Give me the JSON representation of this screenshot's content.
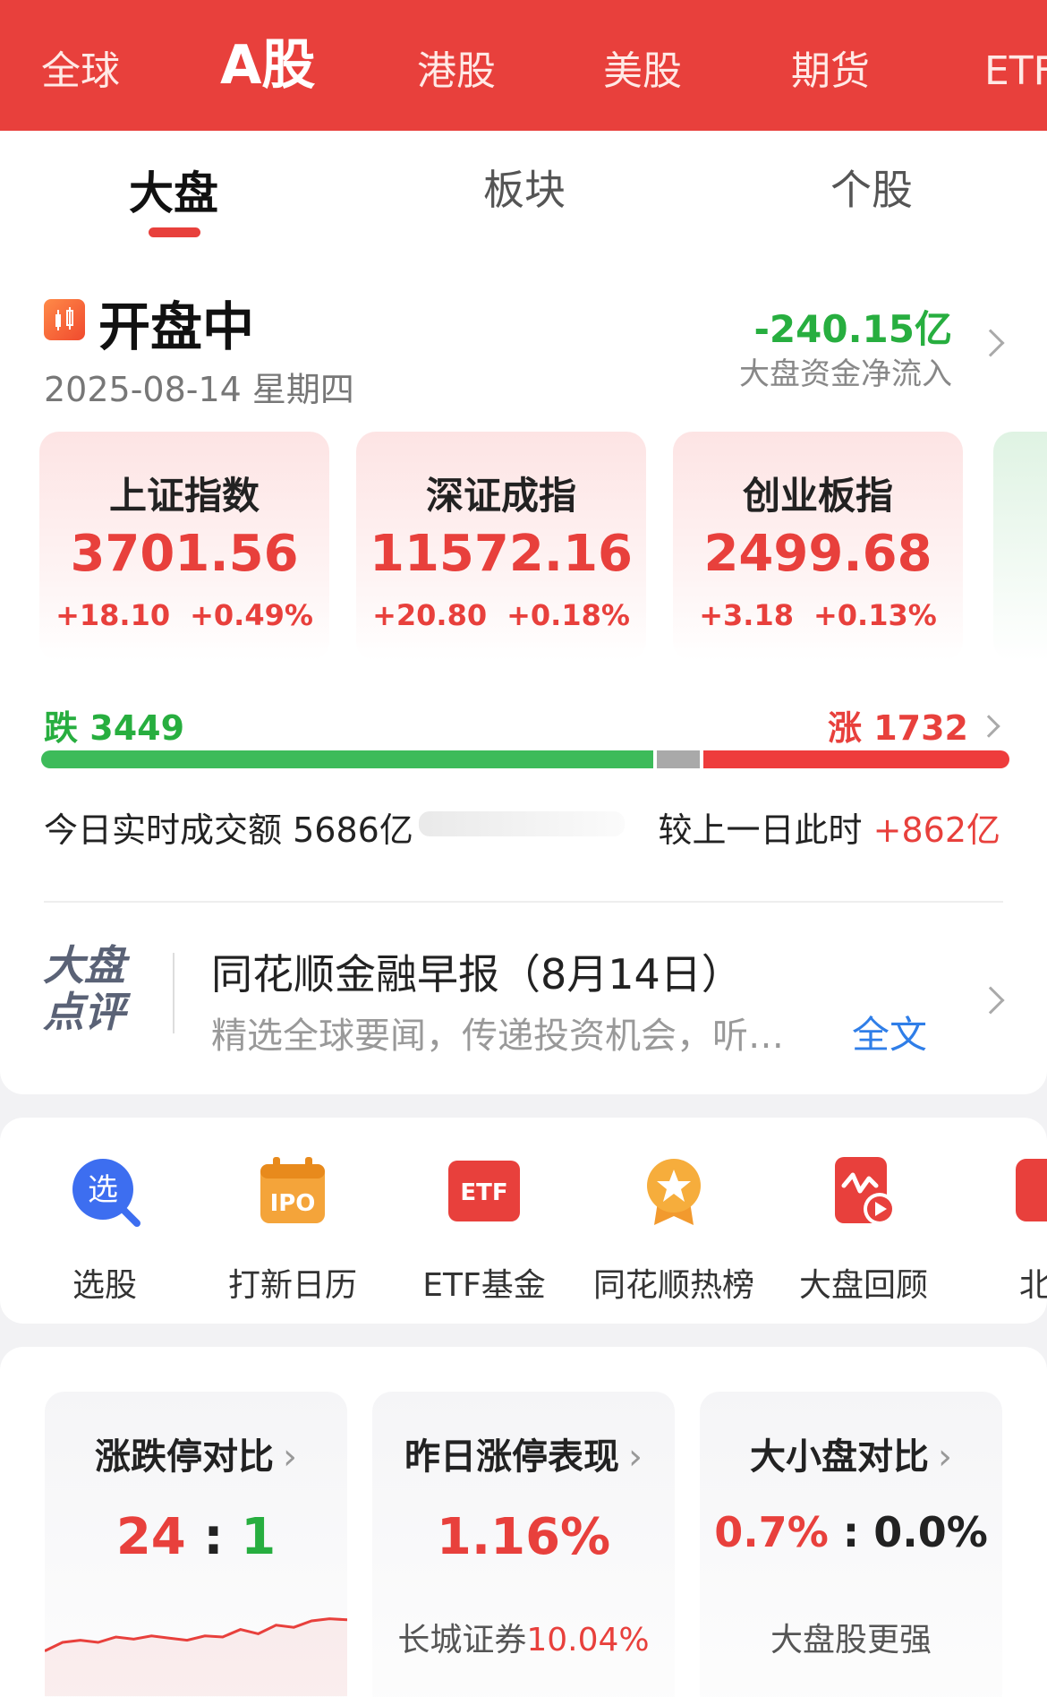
{
  "market_tabs": [
    "全球",
    "A股",
    "港股",
    "美股",
    "期货",
    "ETF"
  ],
  "sub_tabs": [
    "大盘",
    "板块",
    "个股"
  ],
  "status": {
    "title": "开盘中",
    "date": "2025-08-14 星期四"
  },
  "fund_flow": {
    "value": "-240.15亿",
    "label": "大盘资金净流入"
  },
  "indices": [
    {
      "name": "上证指数",
      "value": "3701.56",
      "change": "+18.10",
      "pct": "+0.49%"
    },
    {
      "name": "深证成指",
      "value": "11572.16",
      "change": "+20.80",
      "pct": "+0.18%"
    },
    {
      "name": "创业板指",
      "value": "2499.68",
      "change": "+3.18",
      "pct": "+0.13%"
    }
  ],
  "breadth": {
    "fall_label": "跌",
    "fall_count": "3449",
    "rise_label": "涨",
    "rise_count": "1732",
    "fall_share": 0.637,
    "flat_share": 0.045,
    "rise_share": 0.318,
    "colors": {
      "fall": "#3dbb5a",
      "flat": "#a9a9a9",
      "rise": "#ee3c3c"
    }
  },
  "turnover": {
    "label": "今日实时成交额",
    "value": "5686亿",
    "compare_label": "较上一日此时",
    "compare_value": "+862亿"
  },
  "news": {
    "logo_line1": "大盘",
    "logo_line2": "点评",
    "title": "同花顺金融早报（8月14日）",
    "desc": "精选全球要闻，传递投资机会，听…",
    "more": "全文"
  },
  "tools": [
    {
      "label": "选股",
      "icon": "search-stock-icon"
    },
    {
      "label": "打新日历",
      "icon": "ipo-calendar-icon"
    },
    {
      "label": "ETF基金",
      "icon": "etf-icon"
    },
    {
      "label": "同花顺热榜",
      "icon": "hot-list-medal-icon"
    },
    {
      "label": "大盘回顾",
      "icon": "market-review-icon"
    },
    {
      "label": "北交",
      "icon": "beijing-exchange-icon"
    }
  ],
  "stats": {
    "limit": {
      "title": "涨跌停对比",
      "up": "24",
      "sep": ":",
      "down": "1",
      "trend": [
        0.42,
        0.5,
        0.52,
        0.5,
        0.55,
        0.53,
        0.56,
        0.54,
        0.52,
        0.56,
        0.55,
        0.62,
        0.58,
        0.66,
        0.64,
        0.7,
        0.72,
        0.71
      ]
    },
    "yesterday": {
      "title": "昨日涨停表现",
      "value": "1.16%",
      "stock": "长城证券",
      "stock_pct": "10.04%"
    },
    "cap": {
      "title": "大小盘对比",
      "left": "0.7%",
      "sep": ":",
      "right": "0.0%",
      "note": "大盘股更强"
    }
  }
}
